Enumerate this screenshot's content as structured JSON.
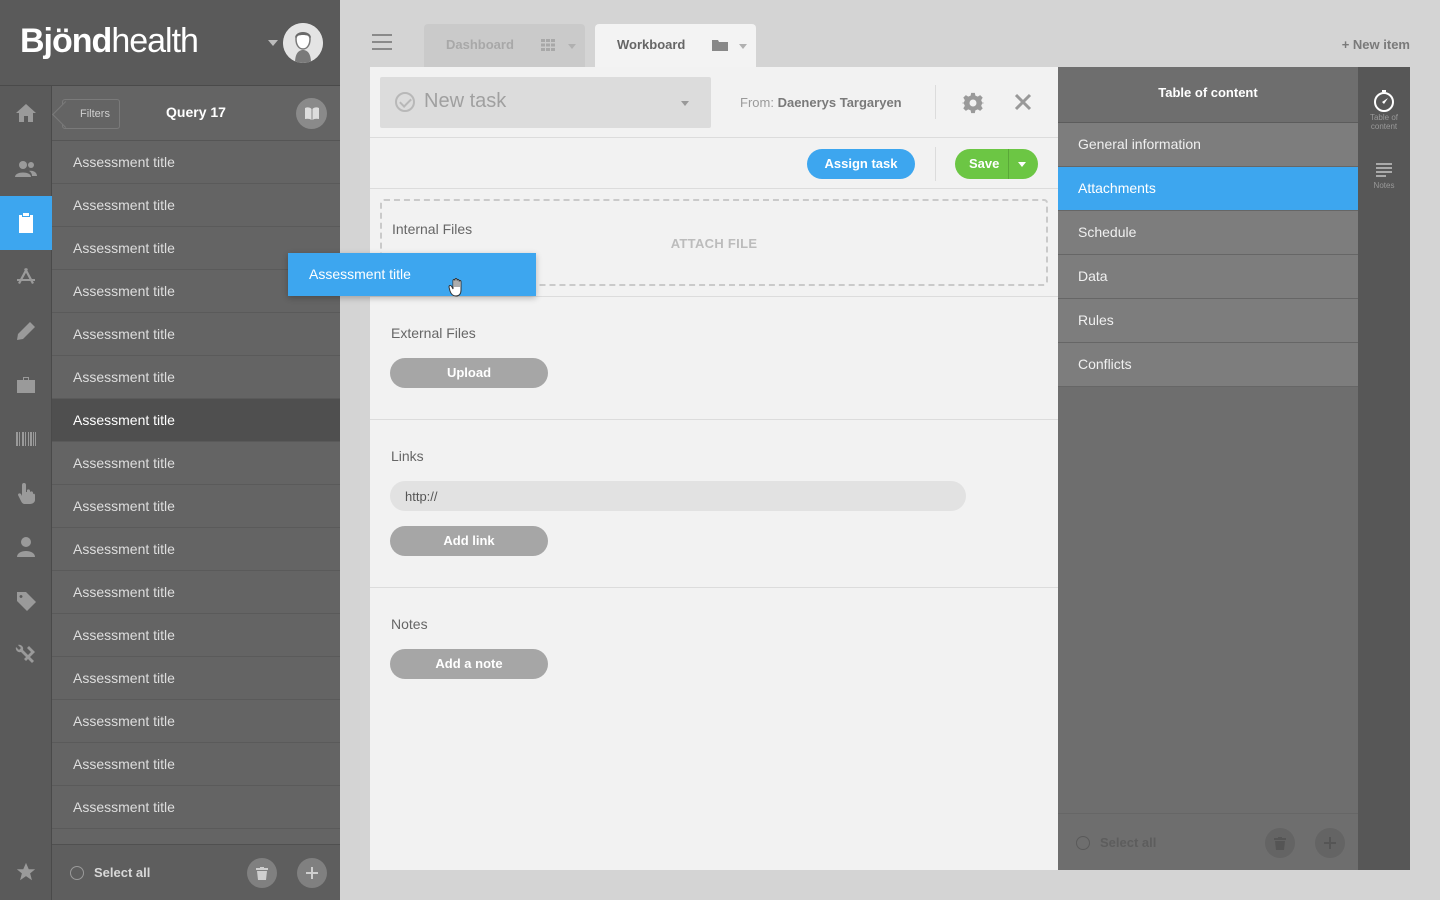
{
  "brand": {
    "logo_bold": "Bjönd",
    "logo_light": "health"
  },
  "rail": {
    "items": [
      "home-icon",
      "users-icon",
      "clipboard-icon",
      "app-store-icon",
      "pen-icon",
      "briefcase-icon",
      "barcode-icon",
      "touch-icon",
      "person-icon",
      "tag-icon",
      "tools-icon",
      "star-icon"
    ],
    "active": "clipboard-icon",
    "accent": "#3da6ef"
  },
  "list": {
    "filters_label": "Filters",
    "query_title": "Query 17",
    "items": [
      "Assessment title",
      "Assessment title",
      "Assessment title",
      "Assessment title",
      "Assessment title",
      "Assessment title",
      "Assessment title",
      "Assessment title",
      "Assessment title",
      "Assessment title",
      "Assessment title",
      "Assessment title",
      "Assessment title",
      "Assessment title",
      "Assessment title",
      "Assessment title"
    ],
    "selected_index": 6,
    "select_all": "Select all"
  },
  "tabs": [
    {
      "label": "Dashboard",
      "icon": "grid-icon"
    },
    {
      "label": "Workboard",
      "icon": "folder-icon"
    }
  ],
  "new_item": "+ New item",
  "task": {
    "name": "New task",
    "from_prefix": "From:",
    "from_name": "Daenerys Targaryen",
    "assign_label": "Assign task",
    "save_label": "Save"
  },
  "sections": {
    "internal_files": "Internal Files",
    "attach_file": "ATTACH FILE",
    "external_files": "External Files",
    "upload": "Upload",
    "links": "Links",
    "link_value": "http://",
    "add_link": "Add link",
    "notes": "Notes",
    "add_note": "Add a note"
  },
  "drag": {
    "label": "Assessment title"
  },
  "toc": {
    "title": "Table of content",
    "items": [
      "General information",
      "Attachments",
      "Schedule",
      "Data",
      "Rules",
      "Conflicts"
    ],
    "active": "Attachments",
    "select_all": "Select all"
  },
  "side_tools": [
    {
      "caption": "Table of content",
      "icon": "compass-icon"
    },
    {
      "caption": "Notes",
      "icon": "notes-icon"
    }
  ],
  "colors": {
    "primary": "#3da6ef",
    "success": "#6cc644"
  }
}
